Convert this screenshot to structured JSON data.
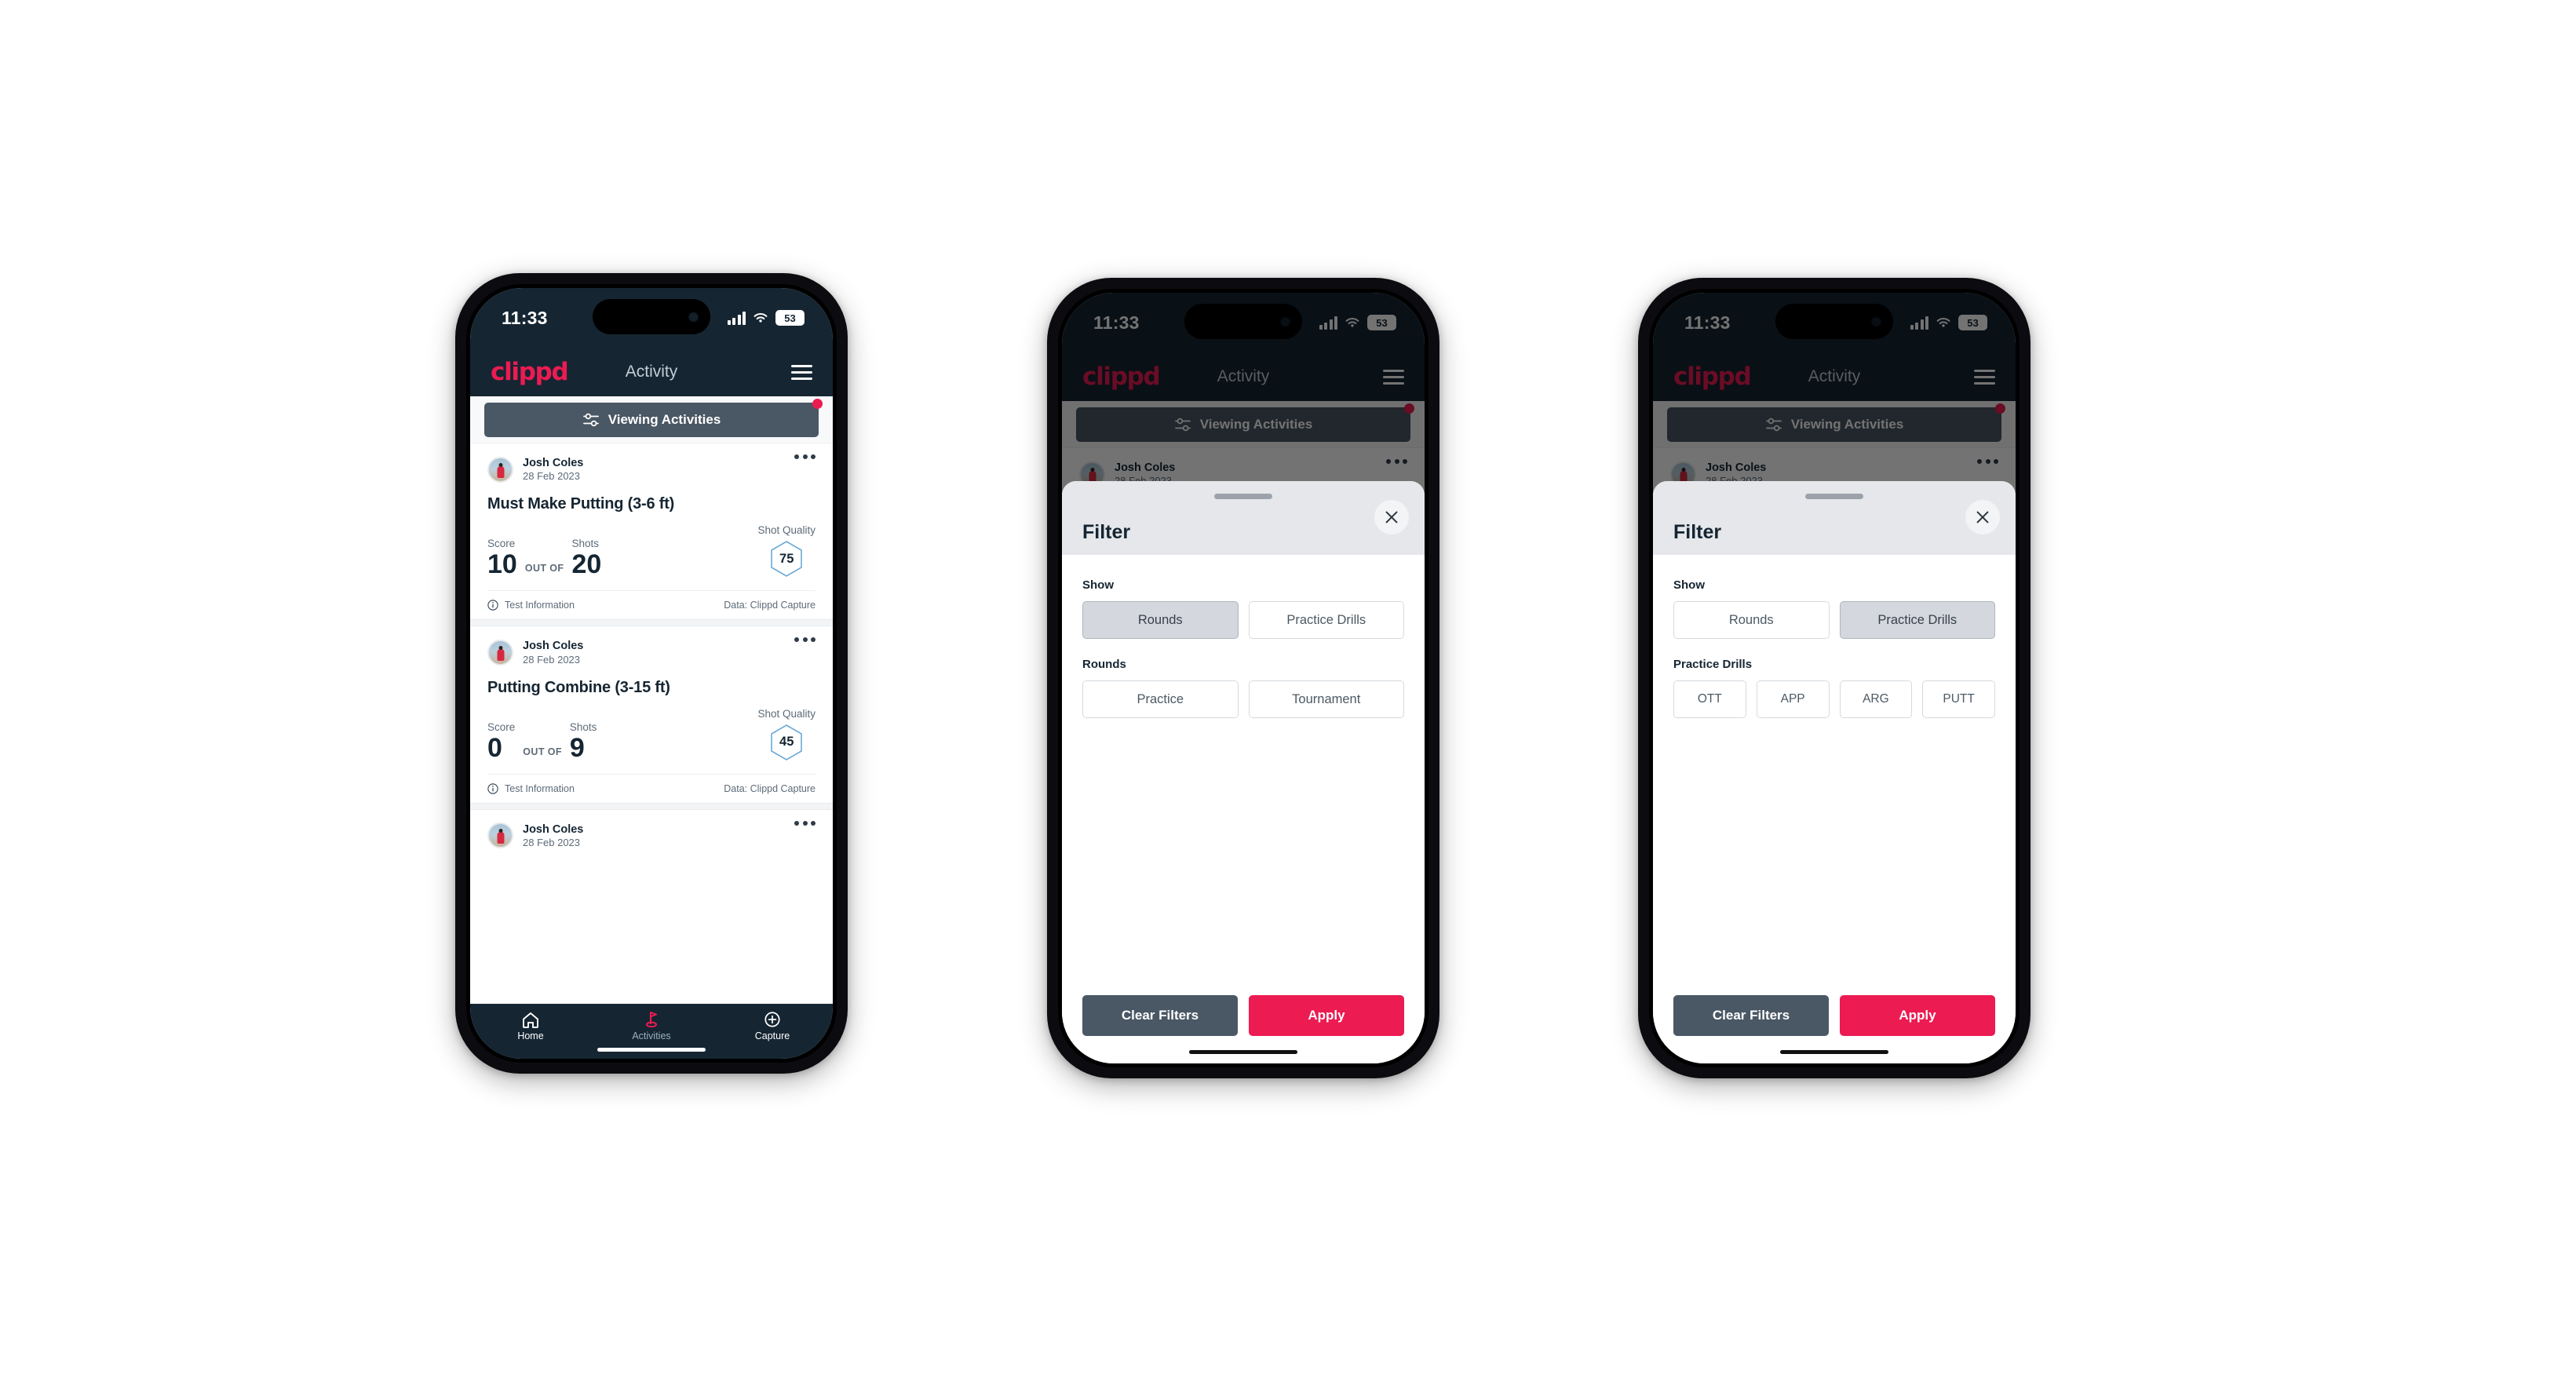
{
  "status_bar": {
    "time": "11:33",
    "battery": "53",
    "signal_icon": "cellular-signal-icon",
    "wifi_icon": "wifi-icon"
  },
  "app_header": {
    "brand": "clippd",
    "title": "Activity",
    "menu_icon": "hamburger-menu-icon"
  },
  "filter_bar": {
    "label": "Viewing Activities",
    "icon": "tune-filter-icon",
    "badge_color": "#ec1b52"
  },
  "feed": {
    "cards": [
      {
        "user": "Josh Coles",
        "date": "28 Feb 2023",
        "title": "Must Make Putting (3-6 ft)",
        "score_label": "Score",
        "shots_label": "Shots",
        "quality_label": "Shot Quality",
        "score": "10",
        "out_of": "OUT OF",
        "shots": "20",
        "shot_quality": "75",
        "footer_left": "Test Information",
        "footer_right": "Data: Clippd Capture"
      },
      {
        "user": "Josh Coles",
        "date": "28 Feb 2023",
        "title": "Putting Combine (3-15 ft)",
        "score_label": "Score",
        "shots_label": "Shots",
        "quality_label": "Shot Quality",
        "score": "0",
        "out_of": "OUT OF",
        "shots": "9",
        "shot_quality": "45",
        "footer_left": "Test Information",
        "footer_right": "Data: Clippd Capture"
      },
      {
        "user": "Josh Coles",
        "date": "28 Feb 2023"
      }
    ]
  },
  "bottom_nav": {
    "items": [
      {
        "label": "Home",
        "icon": "home-icon",
        "active": false
      },
      {
        "label": "Activities",
        "icon": "golf-flag-icon",
        "active": true
      },
      {
        "label": "Capture",
        "icon": "plus-circle-icon",
        "active": false
      }
    ]
  },
  "filter_sheet": {
    "title": "Filter",
    "close_icon": "close-x-icon",
    "show_label": "Show",
    "show_options": [
      "Rounds",
      "Practice Drills"
    ],
    "rounds_label": "Rounds",
    "rounds_options": [
      "Practice",
      "Tournament"
    ],
    "practice_drills_label": "Practice Drills",
    "practice_drills_options": [
      "OTT",
      "APP",
      "ARG",
      "PUTT"
    ],
    "clear_label": "Clear Filters",
    "apply_label": "Apply",
    "apply_color": "#ec1b52",
    "clear_color": "#4a5764"
  },
  "screens": {
    "phone2": {
      "selected_show": "Rounds",
      "section": "rounds"
    },
    "phone3": {
      "selected_show": "Practice Drills",
      "section": "practice_drills"
    }
  }
}
